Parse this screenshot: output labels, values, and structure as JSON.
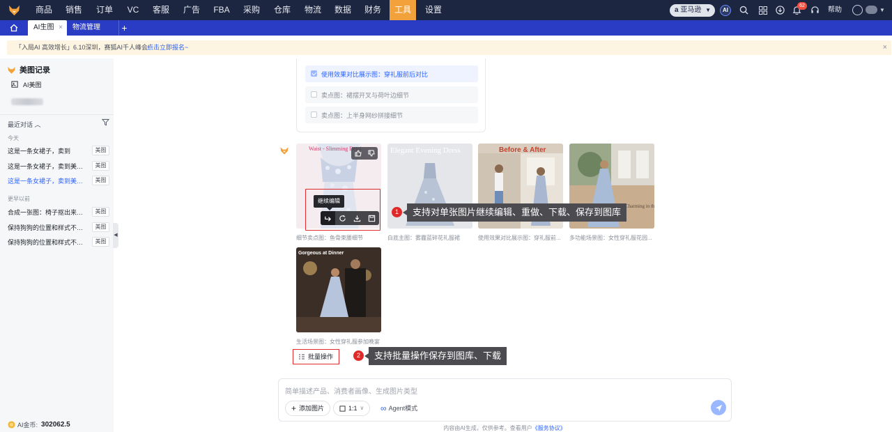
{
  "nav": {
    "menu": [
      "商品",
      "销售",
      "订单",
      "VC",
      "客服",
      "广告",
      "FBA",
      "采购",
      "仓库",
      "物流",
      "数据",
      "财务",
      "工具",
      "设置"
    ],
    "active_menu": "工具",
    "store": "亚马逊",
    "ai_label": "AI",
    "notification_count": "62",
    "help": "帮助"
  },
  "tabs": [
    {
      "label": "AI生图",
      "close": "×"
    },
    {
      "label": "物流管理"
    }
  ],
  "banner": {
    "text": "「入局AI 高效增长」6.10深圳，赛狐AI千人峰会!",
    "link": "点击立即报名~",
    "close": "×"
  },
  "sidebar": {
    "title": "美图记录",
    "ai_item": "AI美图",
    "recent_label": "最近对话",
    "groups": [
      {
        "label": "今天",
        "items": [
          {
            "text": "这是一条女裙子，卖到",
            "tag": "美图"
          },
          {
            "text": "这是一条女裙子，卖到美国。...",
            "tag": "美图"
          },
          {
            "text": "这是一条女裙子，卖到美国。...",
            "tag": "美图"
          }
        ]
      },
      {
        "label": "更早以前",
        "items": [
          {
            "text": "合成一张图：椅子抠出来放在...",
            "tag": "美图"
          },
          {
            "text": "保持狗狗的位置和样式不变，...",
            "tag": "美图"
          },
          {
            "text": "保持狗狗的位置和样式不变，...",
            "tag": "美图"
          }
        ]
      }
    ],
    "coin_label": "AI金币:",
    "coin_value": "302062.5"
  },
  "options": [
    {
      "label": "使用效果对比展示图：穿礼服前后对比",
      "selected": true
    },
    {
      "label": "卖点图：裙摆开叉与荷叶边细节",
      "selected": false
    },
    {
      "label": "卖点图：上半身网纱拼接细节",
      "selected": false
    }
  ],
  "images": [
    {
      "overlay": "Waist - Slimming Detai",
      "caption": "细节卖点图：鱼骨束腰细节"
    },
    {
      "overlay": "Elegant Evening Dress",
      "caption": "白底主图：雾霾蓝碎花礼服裙"
    },
    {
      "overlay": "Before & After",
      "caption": "使用效果对比展示图：穿礼服前..."
    },
    {
      "overlay": "Charming in the Garden",
      "caption": "多功能场景图：女性穿礼服花园..."
    },
    {
      "overlay": "Gorgeous at Dinner",
      "caption": "生活场景图：女性穿礼服参加晚宴"
    }
  ],
  "tooltip": "继续编辑",
  "callouts": [
    {
      "num": "1",
      "text": "支持对单张图片继续编辑、重做、下载、保存到图库"
    },
    {
      "num": "2",
      "text": "支持批量操作保存到图库、下载"
    }
  ],
  "batch_label": "批量操作",
  "composer": {
    "placeholder": "简单描述产品、消费者画像、生成图片类型",
    "add_image": "添加图片",
    "ratio": "1:1",
    "agent": "Agent模式"
  },
  "footer": {
    "text": "内容由AI生成，仅供参考。查看用户",
    "link": "《服务协议》"
  },
  "colors": {
    "nav_bg": "#1c2640",
    "tab_bg": "#2b3cc4",
    "accent": "#f3a13a",
    "link": "#2d63ff",
    "highlight": "#e02a2a"
  }
}
